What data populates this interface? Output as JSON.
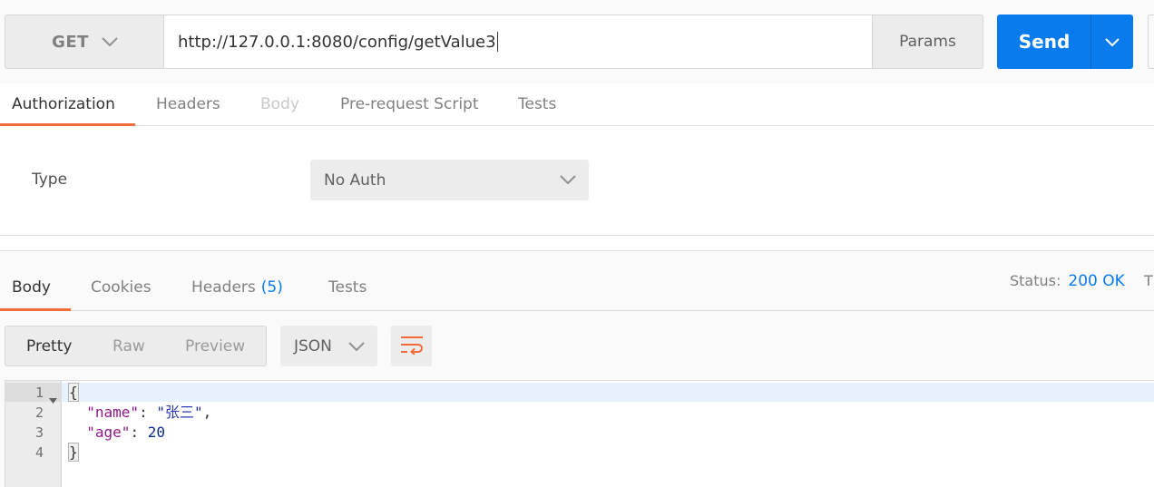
{
  "request": {
    "method": "GET",
    "url": "http://127.0.0.1:8080/config/getValue3",
    "params_label": "Params",
    "send_label": "Send"
  },
  "request_tabs": [
    {
      "label": "Authorization",
      "state": "active"
    },
    {
      "label": "Headers",
      "state": "normal"
    },
    {
      "label": "Body",
      "state": "disabled"
    },
    {
      "label": "Pre-request Script",
      "state": "normal"
    },
    {
      "label": "Tests",
      "state": "normal"
    }
  ],
  "auth": {
    "type_label": "Type",
    "type_value": "No Auth"
  },
  "response_tabs": [
    {
      "label": "Body",
      "state": "active"
    },
    {
      "label": "Cookies",
      "state": "normal"
    },
    {
      "label": "Headers",
      "count": "(5)",
      "state": "normal"
    },
    {
      "label": "Tests",
      "state": "normal"
    }
  ],
  "status": {
    "label": "Status:",
    "value": "200 OK",
    "truncated": "T"
  },
  "view_modes": [
    "Pretty",
    "Raw",
    "Preview"
  ],
  "active_view": "Pretty",
  "format": "JSON",
  "editor": {
    "line_numbers": [
      "1",
      "2",
      "3",
      "4"
    ],
    "lines": [
      {
        "open": "{"
      },
      {
        "key": "\"name\"",
        "sep": ": ",
        "value": "\"张三\"",
        "end": ","
      },
      {
        "key": "\"age\"",
        "sep": ": ",
        "value": "20",
        "end": ""
      },
      {
        "close": "}"
      }
    ]
  },
  "colors": {
    "accent_orange": "#f26b3a",
    "send_blue": "#097bed",
    "status_blue": "#097bed"
  },
  "icons": {
    "method_dropdown": "chevron-down-icon",
    "send_dropdown": "chevron-down-icon",
    "auth_dropdown": "chevron-down-icon",
    "format_dropdown": "chevron-down-icon",
    "wrap": "wrap-lines-icon",
    "fold": "fold-triangle-icon"
  }
}
